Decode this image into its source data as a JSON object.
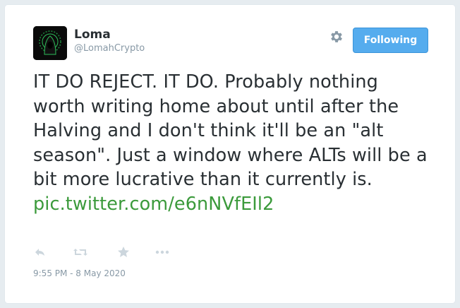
{
  "user": {
    "display_name": "Loma",
    "handle": "@LomahCrypto"
  },
  "follow_button": {
    "label": "Following"
  },
  "tweet": {
    "text": "IT DO REJECT. IT DO. Probably nothing worth writing home about until after the Halving and I don't think it'll be an \"alt season\". Just a window where ALTs will be a bit more lucrative than it currently is.",
    "link": "pic.twitter.com/e6nNVfEIl2",
    "timestamp": "9:55 PM - 8 May 2020"
  },
  "icons": [
    "settings-gear-icon",
    "reply-icon",
    "retweet-icon",
    "favorite-star-icon",
    "more-dots-icon"
  ],
  "colors": {
    "follow_button": "#55acee",
    "link": "#3b9a3b",
    "text": "#292f33",
    "muted": "#8899a6",
    "action_icon": "#ccd6dd"
  }
}
